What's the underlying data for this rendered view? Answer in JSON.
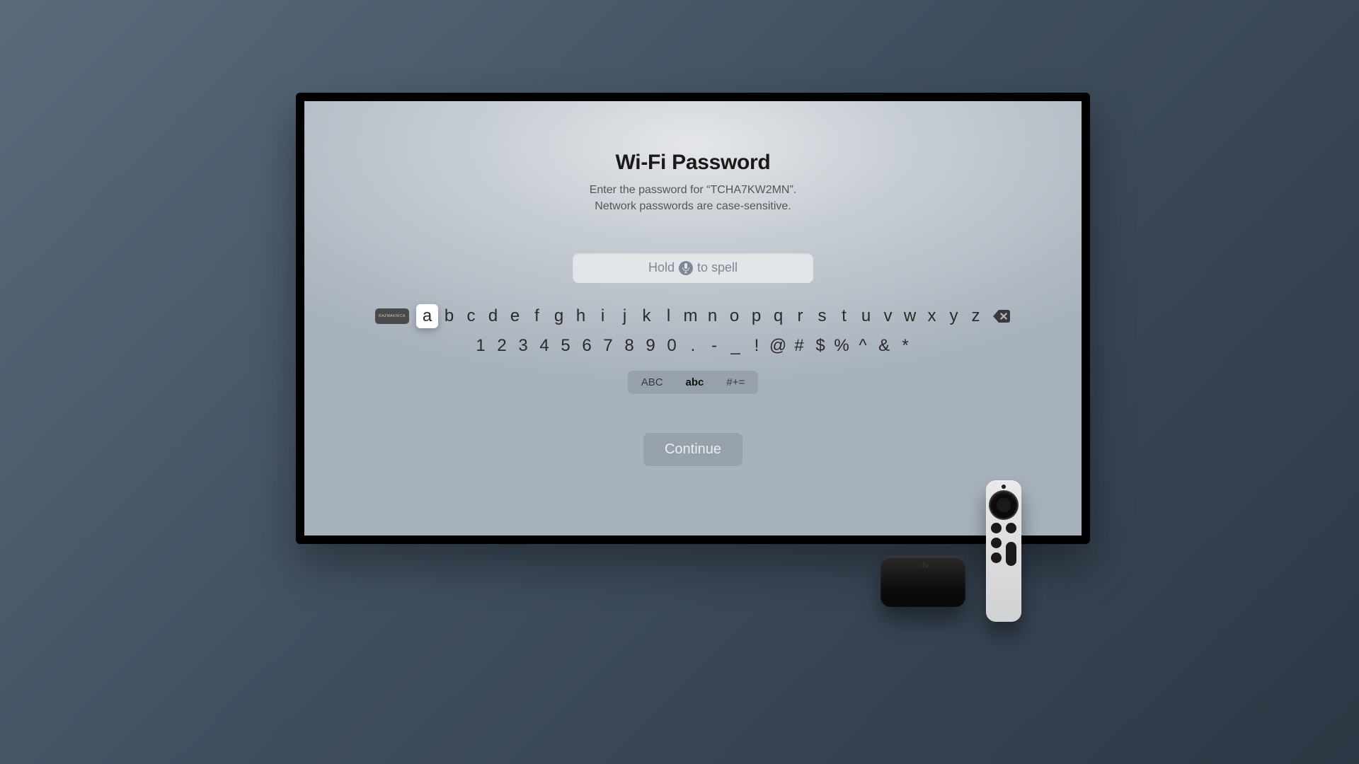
{
  "screen": {
    "title": "Wi-Fi Password",
    "subtitle_line1": "Enter the password for “TCHA7KW2MN”.",
    "subtitle_line2": "Network passwords are case-sensitive.",
    "input_hint_left": "Hold",
    "input_hint_right": "to spell",
    "input_value": "",
    "continue_label": "Continue"
  },
  "keyboard": {
    "spacebar_label": "RAZMAKNICA",
    "row_letters": [
      "a",
      "b",
      "c",
      "d",
      "e",
      "f",
      "g",
      "h",
      "i",
      "j",
      "k",
      "l",
      "m",
      "n",
      "o",
      "p",
      "q",
      "r",
      "s",
      "t",
      "u",
      "v",
      "w",
      "x",
      "y",
      "z"
    ],
    "row_numsym": [
      "1",
      "2",
      "3",
      "4",
      "5",
      "6",
      "7",
      "8",
      "9",
      "0",
      ".",
      "-",
      "_",
      "!",
      "@",
      "#",
      "$",
      "%",
      "^",
      "&",
      "*"
    ],
    "focused_key": "a",
    "modes": {
      "upper": "ABC",
      "lower": "abc",
      "symbols": "#+=",
      "active": "lower"
    }
  },
  "icons": {
    "mic": "microphone-icon",
    "backspace": "backspace-icon"
  }
}
